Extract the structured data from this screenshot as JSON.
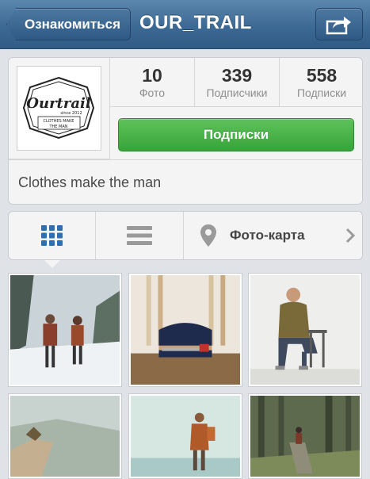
{
  "nav": {
    "back_label": "Ознакомиться",
    "title": "OUR_TRAIL",
    "share_icon": "share-icon"
  },
  "profile": {
    "logo_text": "Ourtrail",
    "logo_since": "since 2012",
    "logo_tagline_1": "CLOTHES MAKE",
    "logo_tagline_2": "THE MAN",
    "stats": [
      {
        "value": "10",
        "label": "Фото"
      },
      {
        "value": "339",
        "label": "Подписчики"
      },
      {
        "value": "558",
        "label": "Подписки"
      }
    ],
    "follow_label": "Подписки",
    "bio": "Clothes make the man"
  },
  "tabs": {
    "grid_icon": "grid-icon",
    "list_icon": "list-icon",
    "map_icon": "location-pin-icon",
    "map_label": "Фото-карта"
  },
  "photos": [
    {
      "subject": "two hikers walking on snowy forest trail"
    },
    {
      "subject": "leather duffel bag with axe on wooden table"
    },
    {
      "subject": "man in plaid shirt sitting on chair"
    },
    {
      "subject": "rocky cliff landscape"
    },
    {
      "subject": "person with backpack near water"
    },
    {
      "subject": "hiker in green forest"
    }
  ],
  "colors": {
    "nav_blue": "#3d6a94",
    "follow_green": "#36a43a",
    "grid_active_blue": "#2f6fb0"
  }
}
